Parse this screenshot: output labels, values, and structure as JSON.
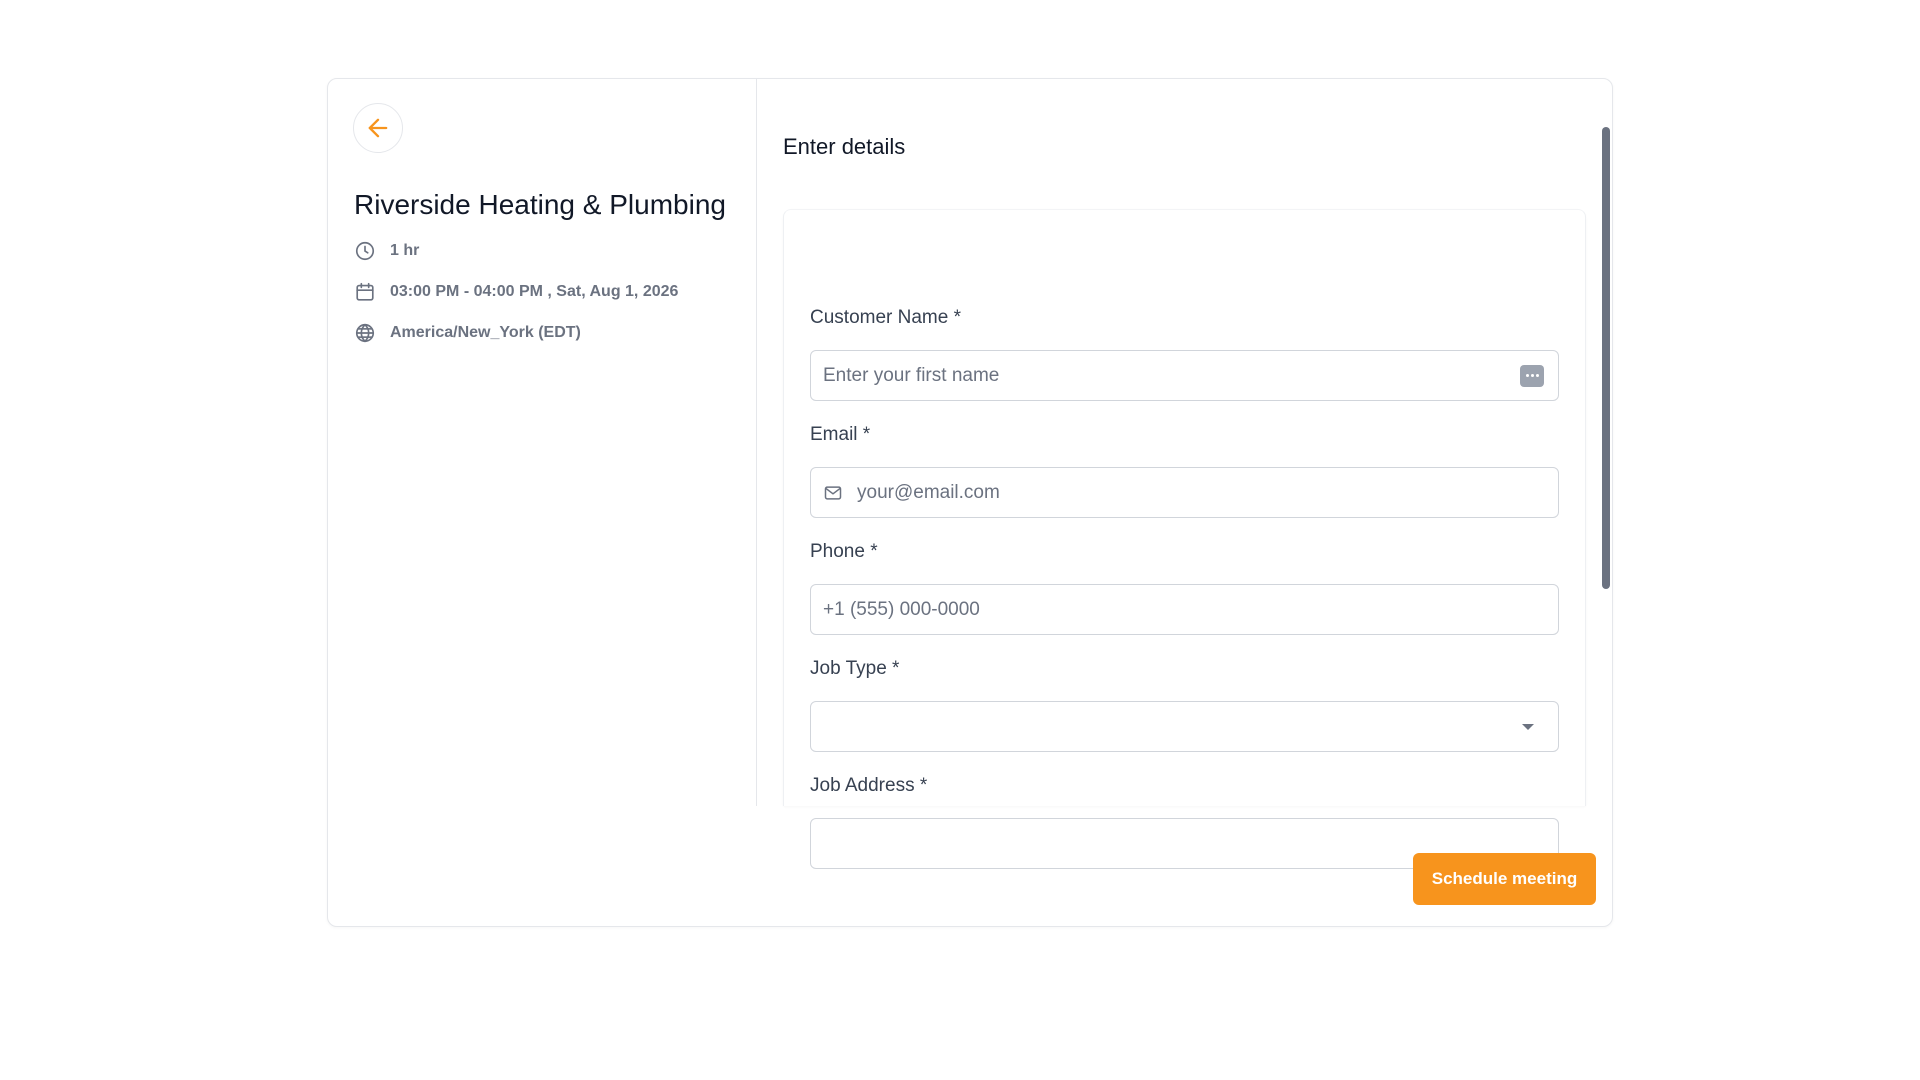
{
  "event": {
    "title": "Riverside Heating & Plumbing",
    "duration": "1 hr",
    "datetime": "03:00 PM - 04:00 PM , Sat, Aug 1, 2026",
    "timezone": "America/New_York (EDT)"
  },
  "form": {
    "section_title": "Enter details",
    "customer_name": {
      "label": "Customer Name *",
      "placeholder": "Enter your first name",
      "value": ""
    },
    "email": {
      "label": "Email *",
      "placeholder": "your@email.com",
      "value": ""
    },
    "phone": {
      "label": "Phone *",
      "placeholder": "+1 (555) 000-0000",
      "value": ""
    },
    "job_type": {
      "label": "Job Type *",
      "selected": ""
    },
    "job_address": {
      "label": "Job Address *",
      "placeholder": "",
      "value": ""
    }
  },
  "actions": {
    "schedule_label": "Schedule meeting"
  },
  "colors": {
    "accent": "#f7941d",
    "text_muted": "#6b7280",
    "border": "#d1d5db"
  },
  "icons": {
    "back": "arrow-left-icon",
    "duration": "clock-icon",
    "date": "calendar-icon",
    "timezone": "globe-icon",
    "email": "mail-icon",
    "autofill": "more-horizontal-icon",
    "select": "chevron-down-icon"
  }
}
